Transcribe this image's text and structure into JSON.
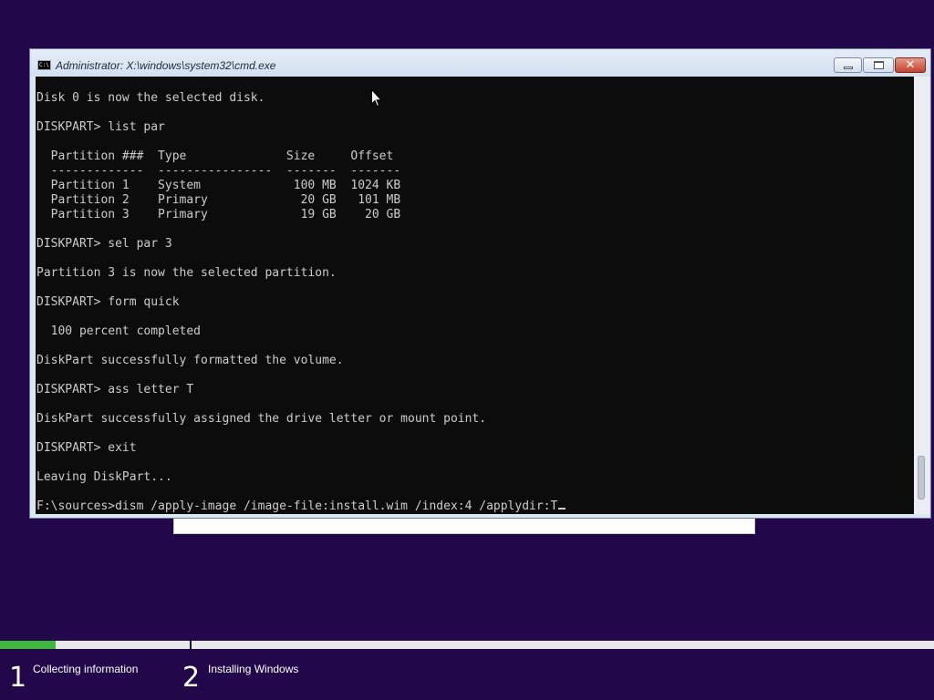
{
  "window": {
    "title": "Administrator: X:\\windows\\system32\\cmd.exe",
    "icon": "cmd-icon",
    "icon_text": "C:\\"
  },
  "console": {
    "lines": [
      "Disk 0 is now the selected disk.",
      "",
      "DISKPART> list par",
      "",
      "  Partition ###  Type              Size     Offset",
      "  -------------  ----------------  -------  -------",
      "  Partition 1    System             100 MB  1024 KB",
      "  Partition 2    Primary             20 GB   101 MB",
      "  Partition 3    Primary             19 GB    20 GB",
      "",
      "DISKPART> sel par 3",
      "",
      "Partition 3 is now the selected partition.",
      "",
      "DISKPART> form quick",
      "",
      "  100 percent completed",
      "",
      "DiskPart successfully formatted the volume.",
      "",
      "DISKPART> ass letter T",
      "",
      "DiskPart successfully assigned the drive letter or mount point.",
      "",
      "DISKPART> exit",
      "",
      "Leaving DiskPart...",
      "",
      "F:\\sources>dism /apply-image /image-file:install.wim /index:4 /applydir:T"
    ]
  },
  "setup": {
    "progress": 0.06,
    "progress_color": "#3dba3d",
    "background_color": "#22074a",
    "steps": [
      {
        "number": "1",
        "label": "Collecting information"
      },
      {
        "number": "2",
        "label": "Installing Windows"
      }
    ]
  }
}
